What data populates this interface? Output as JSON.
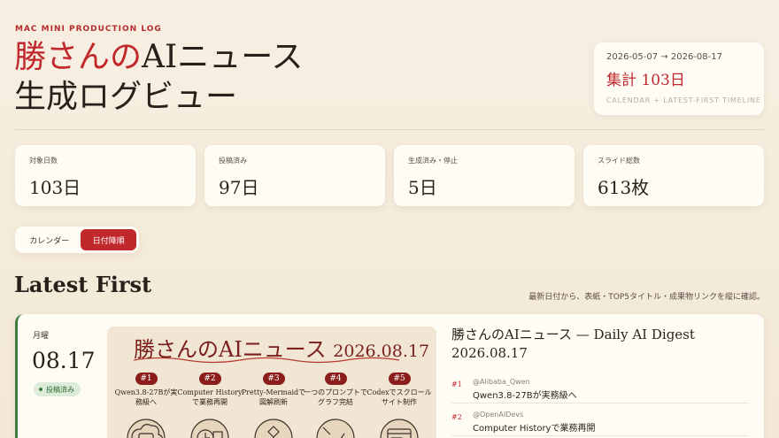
{
  "header": {
    "eyebrow": "MAC MINI PRODUCTION LOG",
    "title_accent": "勝さんの",
    "title_line1_rest": "AIニュース",
    "title_line2": "生成ログビュー"
  },
  "range": {
    "dates": "2026-05-07 → 2026-08-17",
    "total": "集計 103日",
    "subtitle": "CALENDAR + LATEST-FIRST TIMELINE"
  },
  "stats": [
    {
      "label": "対象日数",
      "value": "103日"
    },
    {
      "label": "投稿済み",
      "value": "97日"
    },
    {
      "label": "生成済み・停止",
      "value": "5日"
    },
    {
      "label": "スライド総数",
      "value": "613枚"
    }
  ],
  "view_toggle": {
    "calendar": "カレンダー",
    "date_desc": "日付降順",
    "active": "date_desc"
  },
  "section": {
    "title": "Latest First",
    "subtitle": "最新日付から、表紙・TOP5タイトル・成果物リンクを縦に確認。"
  },
  "entry": {
    "weekday": "月曜",
    "date": "08.17",
    "status": "投稿済み",
    "accent_color": "#3a7d3e",
    "cover": {
      "title": "勝さんのAIニュース",
      "date": "2026.08.17",
      "items": [
        {
          "num": "#1",
          "text": "Qwen3.8-27Bが実務級へ",
          "icon": "chip-cloud-icon"
        },
        {
          "num": "#2",
          "text": "Computer Historyで業務再開",
          "icon": "clock-document-icon"
        },
        {
          "num": "#3",
          "text": "Pretty-Mermaidで図解刷新",
          "icon": "flowchart-icon"
        },
        {
          "num": "#4",
          "text": "一つのプロンプトでグラフ完結",
          "icon": "chart-wand-icon"
        },
        {
          "num": "#5",
          "text": "Codexでスクロールサイト制作",
          "icon": "browser-window-icon"
        }
      ]
    },
    "digest_title": "勝さんのAIニュース — Daily AI Digest 2026.08.17",
    "top": [
      {
        "rank": "#1",
        "source": "@Alibaba_Qwen",
        "title": "Qwen3.8-27Bが実務級へ"
      },
      {
        "rank": "#2",
        "source": "@OpenAIDevs",
        "title": "Computer Historyで業務再開"
      }
    ]
  },
  "colors": {
    "brand_red": "#c0282b",
    "posted_green": "#3a7d3e",
    "background": "#f5ecdc"
  }
}
